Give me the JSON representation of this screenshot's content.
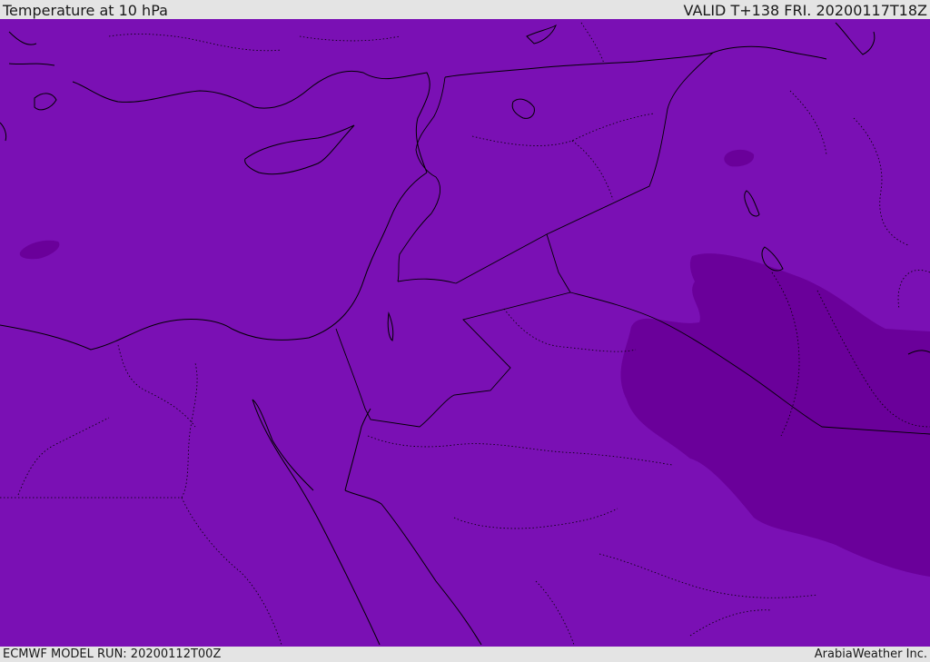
{
  "header": {
    "title": "Temperature at 10 hPa",
    "valid": "VALID T+138 FRI. 20200117T18Z"
  },
  "footer": {
    "model_run": "ECMWF MODEL RUN: 20200112T00Z",
    "credit": "ArabiaWeather Inc."
  },
  "map": {
    "fill_color": "#7a10b4",
    "cold_area_color": "#6a009a",
    "coast_color": "#000000",
    "border_color": "#000000"
  }
}
